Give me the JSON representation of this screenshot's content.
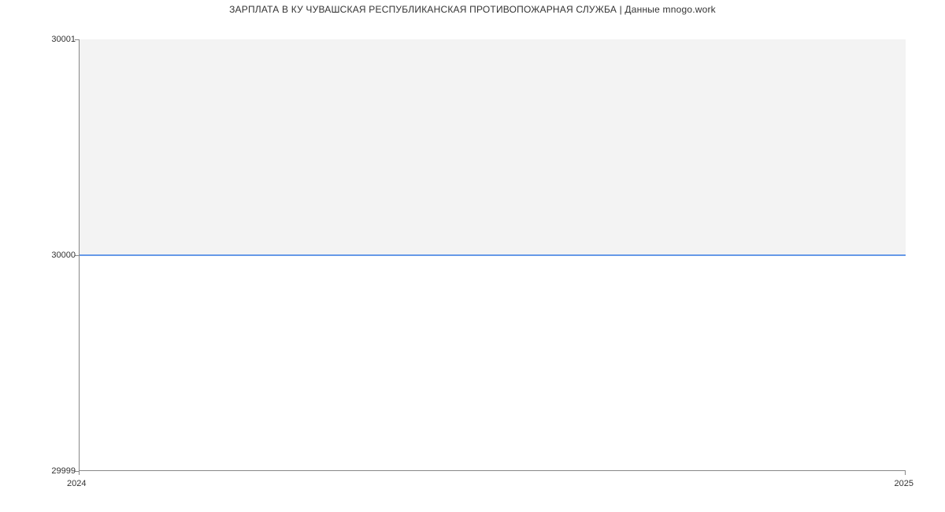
{
  "chart_data": {
    "type": "area",
    "title": "ЗАРПЛАТА В КУ ЧУВАШСКАЯ РЕСПУБЛИКАНСКАЯ ПРОТИВОПОЖАРНАЯ СЛУЖБА | Данные mnogo.work",
    "xlabel": "",
    "ylabel": "",
    "x": [
      2024,
      2025
    ],
    "values": [
      30000,
      30000
    ],
    "xlim": [
      2024,
      2025
    ],
    "ylim": [
      29999,
      30001
    ],
    "x_ticks": [
      "2024",
      "2025"
    ],
    "y_ticks": [
      "29999",
      "30000",
      "30001"
    ],
    "line_color": "#6699e8",
    "fill_color": "#f3f3f3"
  }
}
